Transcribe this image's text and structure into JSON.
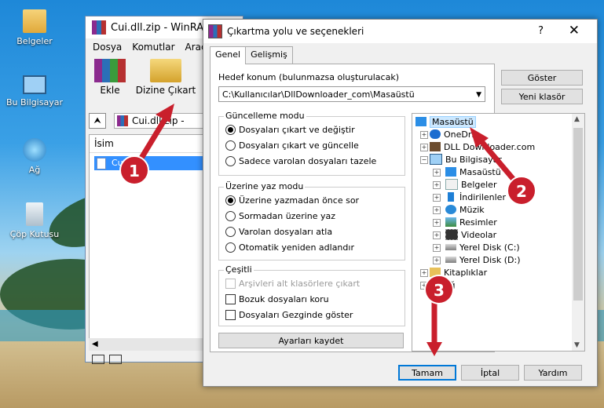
{
  "desktop": {
    "icons": [
      {
        "label": "Belgeler",
        "icon": "folder-documents-icon"
      },
      {
        "label": "Bu Bilgisayar",
        "icon": "computer-icon"
      },
      {
        "label": "Ağ",
        "icon": "network-icon"
      },
      {
        "label": "Çöp Kutusu",
        "icon": "recycle-bin-icon"
      }
    ]
  },
  "winrar": {
    "title": "Cui.dll.zip - WinRAR",
    "menu": [
      "Dosya",
      "Komutlar",
      "Araçla"
    ],
    "tools": {
      "add": "Ekle",
      "extract": "Dizine Çıkart"
    },
    "path": "Cui.dll.zip - ",
    "column_name": "İsim",
    "row_file": "Cui"
  },
  "dialog": {
    "title": "Çıkartma yolu ve seçenekleri",
    "help": "?",
    "close": "✕",
    "tabs": [
      "Genel",
      "Gelişmiş"
    ],
    "dest_label": "Hedef konum (bulunmazsa oluşturulacak)",
    "dest_value": "C:\\Kullanıcılar\\DllDownloader_com\\Masaüstü",
    "show_button": "Göster",
    "new_folder_button": "Yeni klasör",
    "update_group": {
      "title": "Güncelleme modu",
      "options": [
        "Dosyaları çıkart ve değiştir",
        "Dosyaları çıkart ve güncelle",
        "Sadece varolan dosyaları tazele"
      ],
      "selected": 0
    },
    "overwrite_group": {
      "title": "Üzerine yaz modu",
      "options": [
        "Üzerine yazmadan önce sor",
        "Sormadan üzerine yaz",
        "Varolan dosyaları atla",
        "Otomatik yeniden adlandır"
      ],
      "selected": 0
    },
    "misc_group": {
      "title": "Çeşitli",
      "options": [
        "Arşivleri alt klasörlere çıkart",
        "Bozuk dosyaları koru",
        "Dosyaları Gezginde göster"
      ],
      "disabled_index": 0
    },
    "save_settings": "Ayarları kaydet",
    "ok": "Tamam",
    "cancel": "İptal",
    "help_button": "Yardım",
    "tree": {
      "nodes": [
        {
          "label": "Masaüstü",
          "icon": "desktop-folder-icon",
          "selected": true
        },
        {
          "label": "OneDri",
          "icon": "onedrive-icon"
        },
        {
          "label": "DLL Downloader.com",
          "icon": "user-folder-icon"
        },
        {
          "label": "Bu Bilgisayar",
          "icon": "computer-icon"
        },
        {
          "label": "Masaüstü",
          "icon": "desktop-folder-icon"
        },
        {
          "label": "Belgeler",
          "icon": "documents-icon"
        },
        {
          "label": "İndirilenler",
          "icon": "downloads-icon"
        },
        {
          "label": "Müzik",
          "icon": "music-icon"
        },
        {
          "label": "Resimler",
          "icon": "pictures-icon"
        },
        {
          "label": "Videolar",
          "icon": "videos-icon"
        },
        {
          "label": "Yerel Disk (C:)",
          "icon": "disk-icon"
        },
        {
          "label": "Yerel Disk (D:)",
          "icon": "disk-icon"
        },
        {
          "label": "Kitaplıklar",
          "icon": "libraries-icon"
        },
        {
          "label": "Ağ",
          "icon": "network-icon"
        }
      ]
    }
  },
  "markers": [
    "1",
    "2",
    "3"
  ]
}
